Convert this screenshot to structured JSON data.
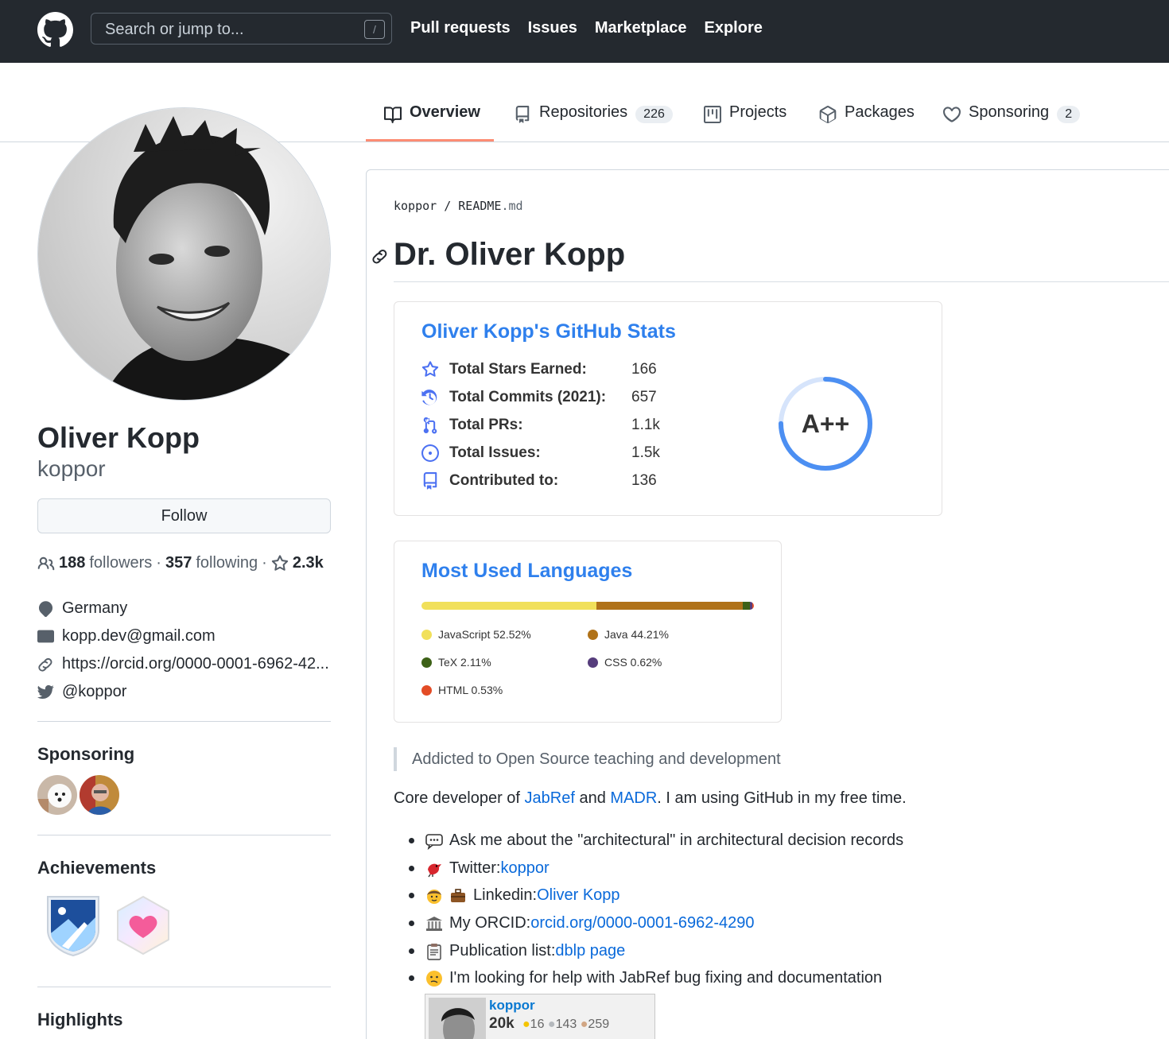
{
  "header": {
    "search_placeholder": "Search or jump to...",
    "slash_key": "/",
    "nav": [
      "Pull requests",
      "Issues",
      "Marketplace",
      "Explore"
    ]
  },
  "tabs": {
    "overview": "Overview",
    "repositories": "Repositories",
    "repositories_count": "226",
    "projects": "Projects",
    "packages": "Packages",
    "sponsoring": "Sponsoring",
    "sponsoring_count": "2"
  },
  "profile": {
    "fullname": "Oliver Kopp",
    "username": "koppor",
    "follow_label": "Follow",
    "followers_count": "188",
    "followers_label": "followers",
    "following_count": "357",
    "following_label": "following",
    "sep": "·",
    "stars": "2.3k",
    "location": "Germany",
    "email": "kopp.dev@gmail.com",
    "website": "https://orcid.org/0000-0001-6962-42...",
    "twitter": "@koppor",
    "sponsoring_title": "Sponsoring",
    "achievements_title": "Achievements",
    "highlights_title": "Highlights"
  },
  "readme": {
    "crumb_user": "koppor",
    "crumb_sep": "/",
    "crumb_file": "README",
    "crumb_ext": ".md",
    "title": "Dr. Oliver Kopp",
    "quote": "Addicted to Open Source teaching and development",
    "para": {
      "pre": "Core developer of ",
      "link1": "JabRef",
      "mid": " and ",
      "link2": "MADR",
      "post": ". I am using GitHub in my free time."
    },
    "list": [
      {
        "text": "Ask me about the \"architectural\" in architectural decision records",
        "link": ""
      },
      {
        "text": "Twitter: ",
        "link": "koppor"
      },
      {
        "text": "Linkedin: ",
        "link": "Oliver Kopp"
      },
      {
        "text": "My ORCID: ",
        "link": "orcid.org/0000-0001-6962-4290"
      },
      {
        "text": "Publication list: ",
        "link": "dblp page"
      },
      {
        "text": "I'm looking for help with JabRef bug fixing and documentation",
        "link": ""
      }
    ]
  },
  "stats": {
    "title": "Oliver Kopp's GitHub Stats",
    "rows": [
      {
        "label": "Total Stars Earned:",
        "value": "166",
        "icon": "star-icon"
      },
      {
        "label": "Total Commits (2021):",
        "value": "657",
        "icon": "history-icon"
      },
      {
        "label": "Total PRs:",
        "value": "1.1k",
        "icon": "pull-request-icon"
      },
      {
        "label": "Total Issues:",
        "value": "1.5k",
        "icon": "issue-icon"
      },
      {
        "label": "Contributed to:",
        "value": "136",
        "icon": "repo-icon"
      }
    ],
    "grade": "A++",
    "grade_progress": 0.75
  },
  "languages": {
    "title": "Most Used Languages",
    "items": [
      {
        "name": "JavaScript 52.52%",
        "pct": 52.52,
        "color": "#f1e05a"
      },
      {
        "name": "Java 44.21%",
        "pct": 44.21,
        "color": "#b07219"
      },
      {
        "name": "TeX 2.11%",
        "pct": 2.11,
        "color": "#3d6117"
      },
      {
        "name": "CSS 0.62%",
        "pct": 0.62,
        "color": "#563d7c"
      },
      {
        "name": "HTML 0.53%",
        "pct": 0.53,
        "color": "#e34c26"
      }
    ]
  },
  "stackoverflow_card": {
    "user": "koppor",
    "rep": "20k",
    "gold": "16",
    "silver": "143",
    "bronze": "259"
  },
  "colors": {
    "header_bg": "#24292f",
    "link": "#0969da",
    "stats_title": "#2f80ed",
    "tab_underline": "#fd8c73"
  }
}
